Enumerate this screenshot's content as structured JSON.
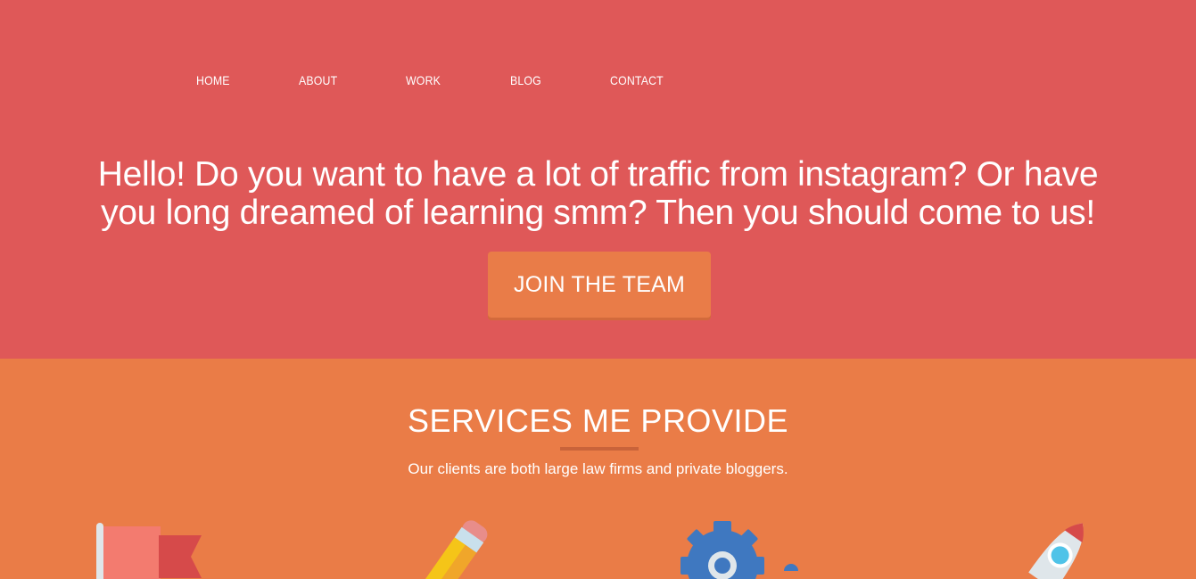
{
  "nav": {
    "items": [
      {
        "label": "HOME"
      },
      {
        "label": "ABOUT"
      },
      {
        "label": "WORK"
      },
      {
        "label": "BLOG"
      },
      {
        "label": "CONTACT"
      }
    ]
  },
  "hero": {
    "headline": "Hello! Do you want to have a lot of traffic from instagram? Or have you long dreamed of learning smm? Then you should come to us!",
    "cta_label": "JOIN THE TEAM"
  },
  "services": {
    "title": "SERVICES ME PROVIDE",
    "subtitle": "Our clients are both large law firms and private bloggers.",
    "icons": [
      "flag-icon",
      "pencil-icon",
      "gear-icon",
      "rocket-icon"
    ]
  },
  "colors": {
    "hero_bg": "#df5858",
    "services_bg": "#ea7c47",
    "button_bg": "#e97c48",
    "text": "#ffffff"
  }
}
